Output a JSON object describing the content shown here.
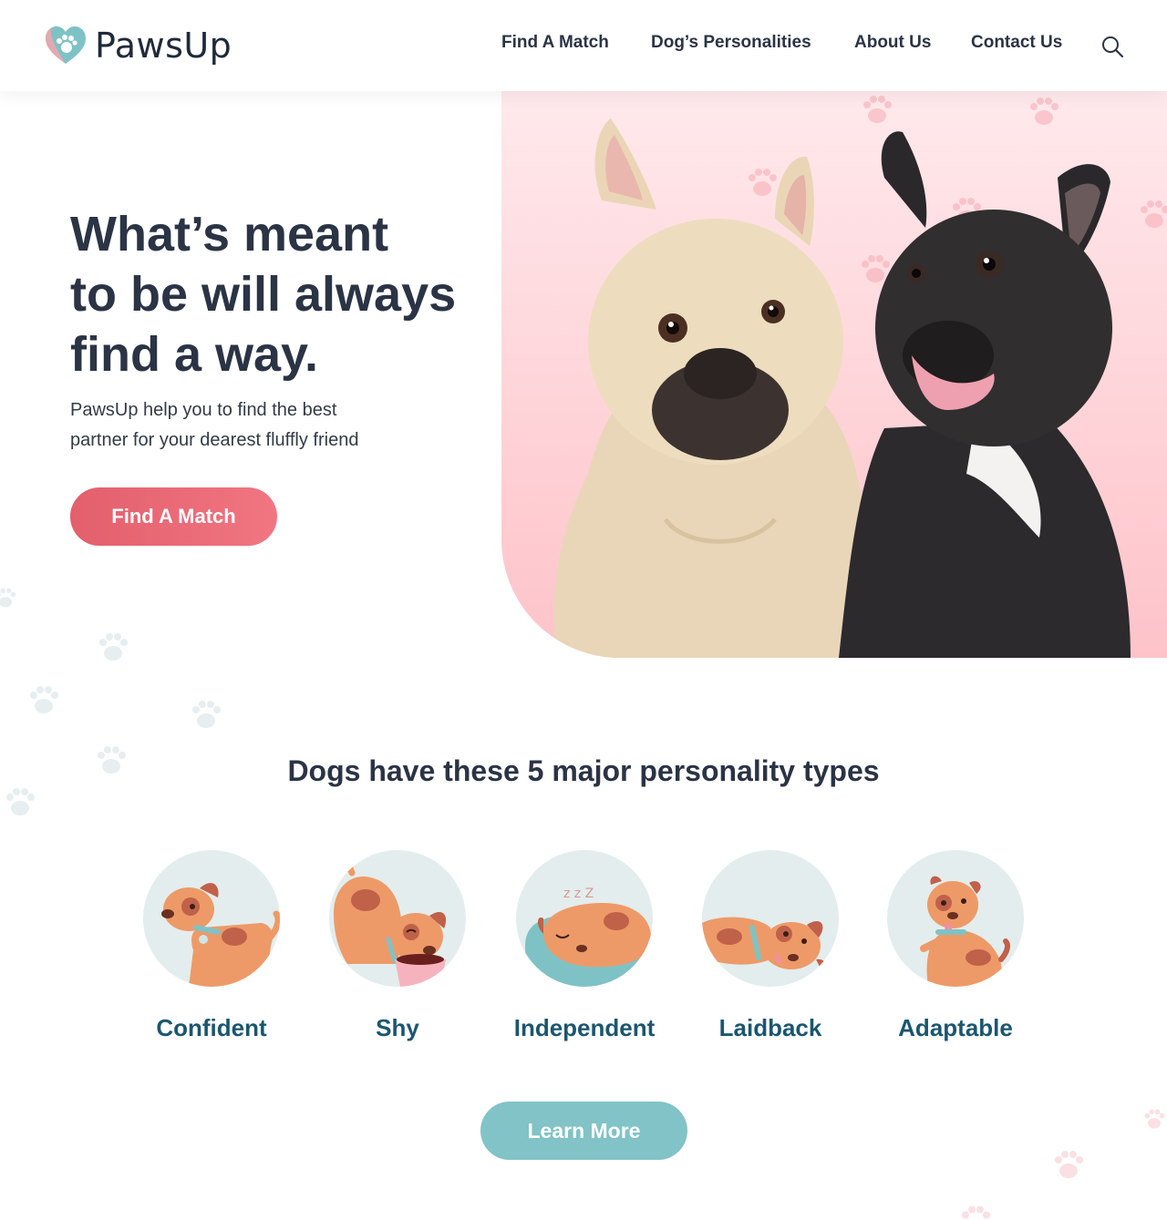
{
  "header": {
    "logo_text": "PawsUp",
    "nav": [
      "Find A Match",
      "Dog’s Personalities",
      "About Us",
      "Contact Us"
    ]
  },
  "hero": {
    "headline_lines": [
      "What’s meant",
      "to be will always",
      "find a way."
    ],
    "subtext_lines": [
      "PawsUp help you to find the best",
      "partner for your dearest fluffly friend"
    ],
    "cta_label": "Find A Match"
  },
  "personalities": {
    "title": "Dogs have these 5 major personality types",
    "items": [
      {
        "label": "Confident"
      },
      {
        "label": "Shy"
      },
      {
        "label": "Independent"
      },
      {
        "label": "Laidback"
      },
      {
        "label": "Adaptable"
      }
    ],
    "cta_label": "Learn More"
  },
  "colors": {
    "accent_pink": "#e8646f",
    "accent_teal": "#81c3c6",
    "text_dark": "#2b3445",
    "label_blue": "#1b5670"
  }
}
